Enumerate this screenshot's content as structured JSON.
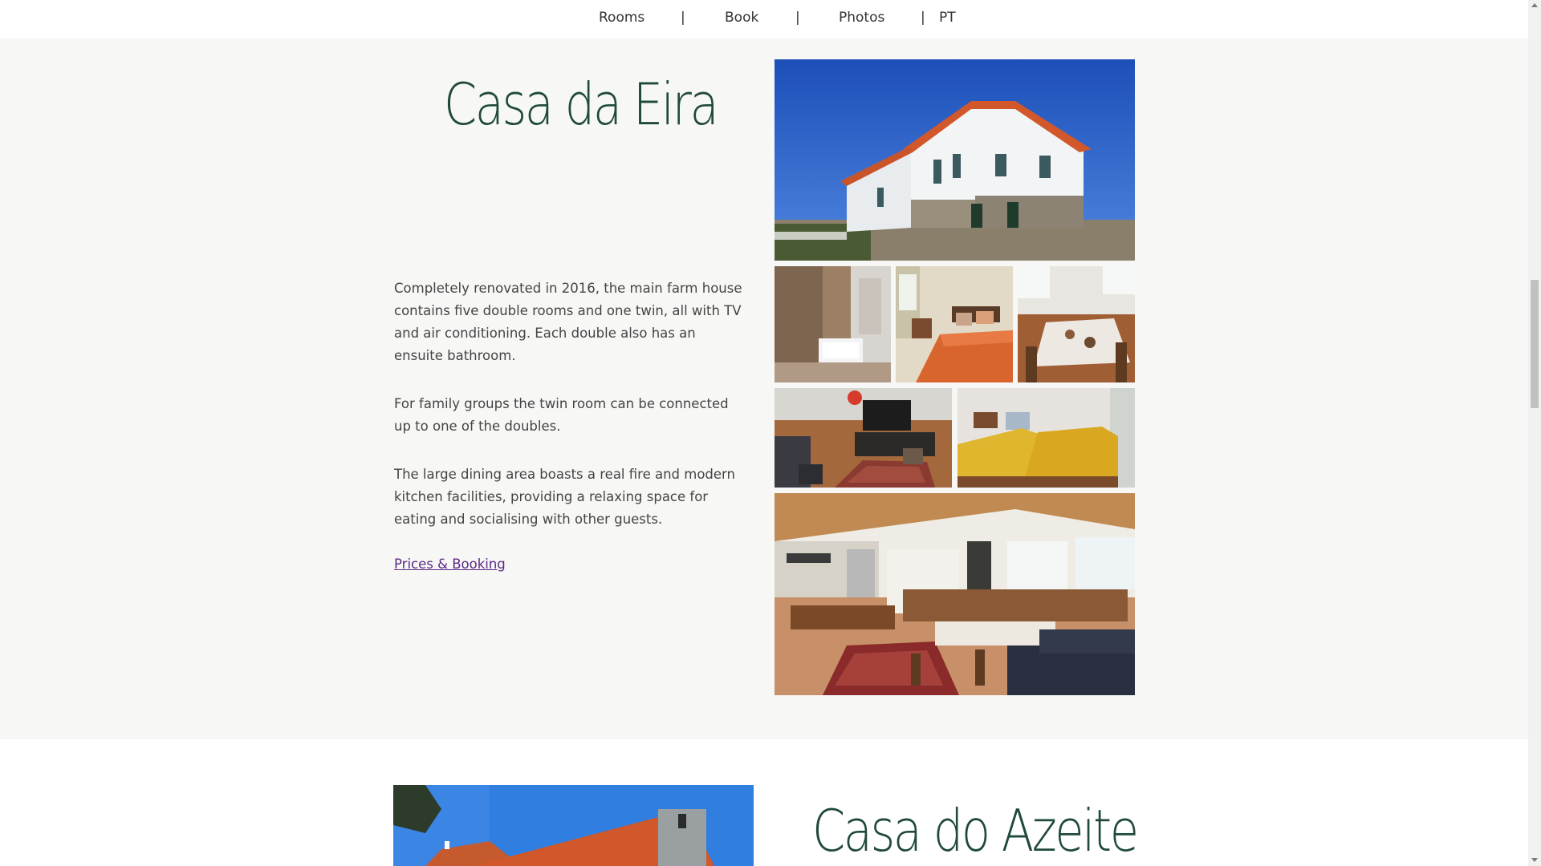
{
  "nav": {
    "items": [
      {
        "label": "Rooms"
      },
      {
        "label": "Book"
      },
      {
        "label": "Photos"
      },
      {
        "label": "PT"
      }
    ],
    "separator": "|"
  },
  "section1": {
    "title": "Casa da Eira",
    "paragraphs": [
      "Completely renovated in 2016, the main farm house contains five double rooms and one twin, all with TV and air conditioning. Each double also has an ensuite bathroom.",
      "For family groups the twin room can be connected up to one of the doubles.",
      "The large dining area boasts a real fire and modern kitchen facilities, providing a relaxing space for eating and socialising with other guests."
    ],
    "link_label": "Prices & Booking",
    "photos": [
      {
        "icon": "house-exterior-photo"
      },
      {
        "icon": "bathroom-photo"
      },
      {
        "icon": "double-bedroom-photo"
      },
      {
        "icon": "dining-table-photo"
      },
      {
        "icon": "living-room-photo"
      },
      {
        "icon": "twin-bedroom-photo"
      },
      {
        "icon": "dining-kitchen-photo"
      }
    ]
  },
  "section2": {
    "title": "Casa do Azeite",
    "photo": {
      "icon": "house-exterior-photo"
    }
  },
  "colors": {
    "title": "#1f4a3a",
    "link": "#5b2a86",
    "section_bg": "#f7f7f6"
  }
}
